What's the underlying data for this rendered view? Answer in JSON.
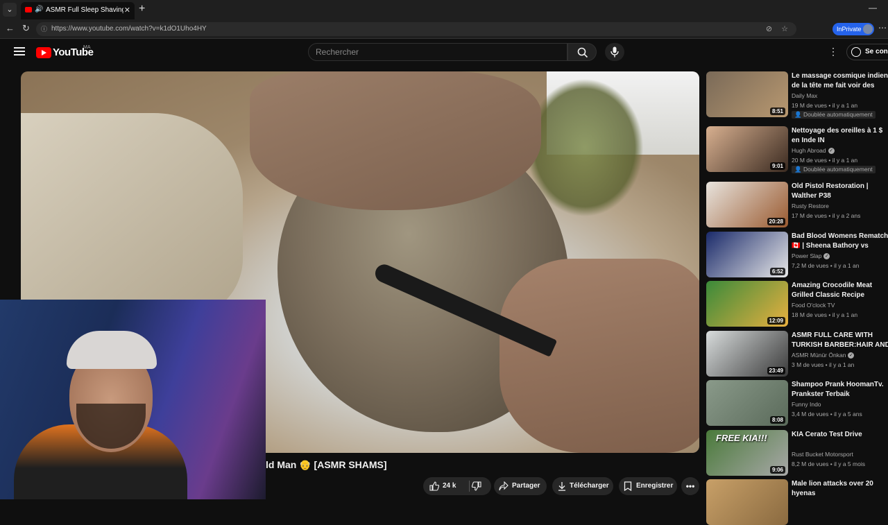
{
  "browser": {
    "tab_title": "ASMR Full Sleep Shaving & H",
    "url": "https://www.youtube.com/watch?v=k1dO1Uho4HY",
    "inprivate_label": "InPrivate"
  },
  "header": {
    "logo_text": "YouTube",
    "country_code": "MA",
    "search_placeholder": "Rechercher",
    "signin_label": "Se conn"
  },
  "video": {
    "title": "ld Man 👴 [ASMR SHAMS]"
  },
  "actions": {
    "likes": "24 k",
    "share": "Partager",
    "download": "Télécharger",
    "save": "Enregistrer"
  },
  "colors": {
    "background": "#0f0f0f",
    "accent": "#ff0000",
    "pill": "#272727",
    "inprivate": "#2563eb"
  },
  "recommendations": [
    {
      "title": "Le massage cosmique indien de la tête me fait voir des étoiles ...",
      "channel": "Daily Max",
      "verified": false,
      "meta": "19 M de vues • il y a 1 an",
      "badge": "Doublée automatiquement",
      "duration": "8:51",
      "thumb_colors": [
        "#7a6a58",
        "#b89870"
      ]
    },
    {
      "title": "Nettoyage des oreilles à 1 $ en Inde IN",
      "channel": "Hugh Abroad",
      "verified": true,
      "meta": "20 M de vues • il y a 1 an",
      "badge": "Doublée automatiquement",
      "duration": "9:01",
      "thumb_colors": [
        "#d8b090",
        "#3a2a20"
      ]
    },
    {
      "title": "Old Pistol Restoration | Walther P38",
      "channel": "Rusty Restore",
      "verified": false,
      "meta": "17 M de vues • il y a 2 ans",
      "badge": "",
      "duration": "20:28",
      "thumb_colors": [
        "#e8e4de",
        "#9a5a30"
      ]
    },
    {
      "title": "Bad Blood Womens Rematch 🇨🇦 | Sheena Bathory vs Jackie ...",
      "channel": "Power Slap",
      "verified": true,
      "meta": "7,2 M de vues • il y a 1 an",
      "badge": "",
      "duration": "6:52",
      "thumb_colors": [
        "#1a2a6a",
        "#e8e8e8"
      ]
    },
    {
      "title": "Amazing Crocodile Meat Grilled Classic Recipe Ingredients ...",
      "channel": "Food O'clock TV",
      "verified": false,
      "meta": "18 M de vues • il y a 1 an",
      "badge": "",
      "duration": "12:09",
      "thumb_colors": [
        "#3a8a3a",
        "#e8b040"
      ]
    },
    {
      "title": "ASMR FULL CARE WITH TURKISH BARBER:HAIR AND ...",
      "channel": "ASMR Münür Önkan",
      "verified": true,
      "meta": "3 M de vues • il y a 1 an",
      "badge": "",
      "duration": "23:49",
      "thumb_colors": [
        "#d8dcdc",
        "#3a3a3a"
      ]
    },
    {
      "title": "Shampoo Prank HoomanTv. Prankster Terbaik",
      "channel": "Funny Indo",
      "verified": false,
      "meta": "3,4 M de vues • il y a 5 ans",
      "badge": "",
      "duration": "8:08",
      "thumb_colors": [
        "#8a9a8a",
        "#5a6a5a"
      ]
    },
    {
      "title": "KIA Cerato Test Drive",
      "channel": "Rust Bucket Motorsport",
      "verified": false,
      "meta": "8,2 M de vues • il y a 5 mois",
      "badge": "",
      "duration": "9:06",
      "thumb_colors": [
        "#4a7a3a",
        "#a8a8a8"
      ],
      "overlay_text": "FREE KIA!!!"
    },
    {
      "title": "Male lion attacks over 20 hyenas",
      "channel": "",
      "verified": false,
      "meta": "",
      "badge": "",
      "duration": "",
      "thumb_colors": [
        "#c8a068",
        "#8a6a40"
      ]
    }
  ]
}
